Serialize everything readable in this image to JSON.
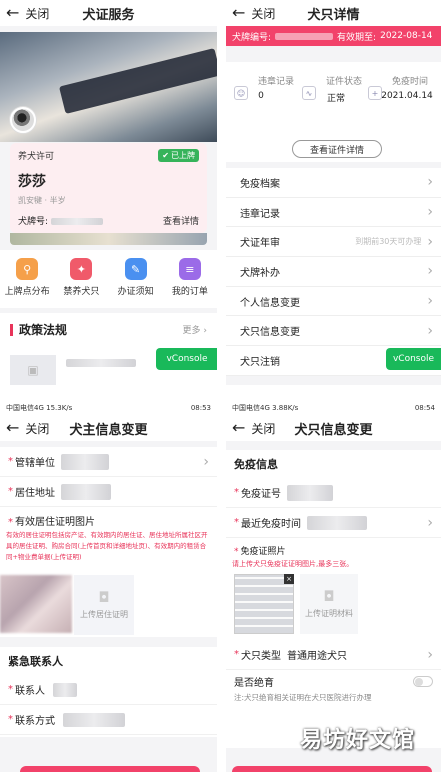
{
  "colors": {
    "accent": "#f2426a",
    "green": "#19b95a"
  },
  "common": {
    "close": "关闭"
  },
  "p1": {
    "title": "犬证服务",
    "license_label": "养犬许可",
    "status_badge": "已上牌",
    "dog_name": "莎莎",
    "dog_info": "凯安犍 · 半岁",
    "tag_label": "犬牌号:",
    "detail_link": "查看详情",
    "icons": [
      {
        "label": "上牌点分布",
        "icon": "location-icon",
        "color": "#f5a04a"
      },
      {
        "label": "禁养犬只",
        "icon": "dog-icon",
        "color": "#f05a6a"
      },
      {
        "label": "办证须知",
        "icon": "notice-icon",
        "color": "#4a90f0"
      },
      {
        "label": "我的订单",
        "icon": "order-icon",
        "color": "#9b6be8"
      }
    ],
    "policy_title": "政策法规",
    "more": "更多",
    "vconsole": "vConsole"
  },
  "p2": {
    "title": "犬只详情",
    "tag_label": "犬牌编号:",
    "valid_label": "有效期至:",
    "valid_date": "2022-08-14",
    "stats": [
      {
        "label": "违章记录",
        "value": "0",
        "icon": "record-icon"
      },
      {
        "label": "证件状态",
        "value": "正常",
        "icon": "status-icon"
      },
      {
        "label": "免疫时间",
        "value": "2021.04.14",
        "icon": "vaccine-icon"
      }
    ],
    "view_license": "查看证件详情",
    "menu": [
      {
        "label": "免疫档案",
        "hint": ""
      },
      {
        "label": "违章记录",
        "hint": ""
      },
      {
        "label": "犬证年审",
        "hint": "到期前30天可办理"
      },
      {
        "label": "犬牌补办",
        "hint": ""
      },
      {
        "label": "个人信息变更",
        "hint": ""
      },
      {
        "label": "犬只信息变更",
        "hint": ""
      },
      {
        "label": "犬只注销",
        "hint": ""
      }
    ],
    "vconsole": "vConsole"
  },
  "p3": {
    "status_left": "中国电信4G",
    "status_speed": "15.3K/s",
    "status_time": "08:53",
    "title": "犬主信息变更",
    "unit_label": "管辖单位",
    "address_label": "居住地址",
    "proof_label": "有效居住证明图片",
    "proof_note": "有效的居住证明包括房产证、有效期内的居住证、居住地址所属社区开具的居住证明、购房合同(上传首页和详细地址页)、有效期内的租赁合同+物业费单据(上传证明)",
    "upload_label": "上传居住证明",
    "contact_title": "紧急联系人",
    "contact_label": "联系人",
    "phone_label": "联系方式"
  },
  "p4": {
    "status_left": "中国电信4G",
    "status_speed": "3.88K/s",
    "status_time": "08:54",
    "title": "犬只信息变更",
    "section_title": "免疫信息",
    "cert_label": "免疫证号",
    "recent_label": "最近免疫时间",
    "photo_label": "免疫证照片",
    "photo_note": "请上传犬只免疫证证明图片,最多三张。",
    "upload_label": "上传证明材料",
    "type_label": "犬只类型",
    "type_value": "普通用途犬只",
    "sterile_label": "是否绝育",
    "sterile_note": "注:犬只绝育相关证明在犬只医院进行办理",
    "watermark": "易坊好文馆"
  }
}
